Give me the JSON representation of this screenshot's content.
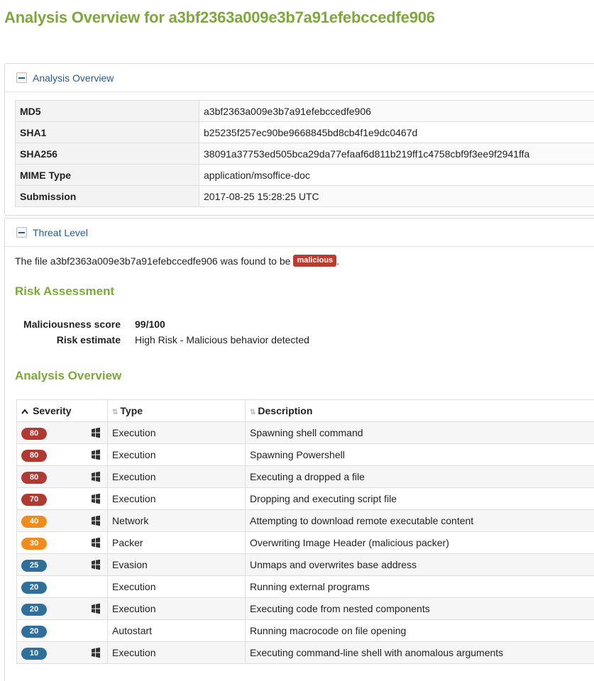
{
  "page_title": "Analysis Overview for a3bf2363a009e3b7a91efebccedfe906",
  "overview_panel": {
    "heading": "Analysis Overview",
    "rows": [
      {
        "key": "MD5",
        "value": "a3bf2363a009e3b7a91efebccedfe906"
      },
      {
        "key": "SHA1",
        "value": "b25235f257ec90be9668845bd8cb4f1e9dc0467d"
      },
      {
        "key": "SHA256",
        "value": "38091a37753ed505bca29da77efaaf6d811b219ff1c4758cbf9f3ee9f2941ffa"
      },
      {
        "key": "MIME Type",
        "value": "application/msoffice-doc"
      },
      {
        "key": "Submission",
        "value": "2017-08-25 15:28:25 UTC"
      }
    ]
  },
  "threat_panel": {
    "heading": "Threat Level",
    "verdict_prefix": "The file a3bf2363a009e3b7a91efebccedfe906 was found to be",
    "verdict_badge": "malicious",
    "verdict_suffix": ".",
    "risk_heading": "Risk Assessment",
    "risk": {
      "score_label": "Maliciousness score",
      "score_value": "99/100",
      "estimate_label": "Risk estimate",
      "estimate_value": "High Risk - Malicious behavior detected"
    },
    "analysis_heading": "Analysis Overview",
    "table": {
      "headers": {
        "severity": "Severity",
        "type": "Type",
        "description": "Description"
      },
      "rows": [
        {
          "score": "80",
          "level": "red",
          "windows_icon": true,
          "type": "Execution",
          "description": "Spawning shell command"
        },
        {
          "score": "80",
          "level": "red",
          "windows_icon": true,
          "type": "Execution",
          "description": "Spawning Powershell"
        },
        {
          "score": "80",
          "level": "red",
          "windows_icon": true,
          "type": "Execution",
          "description": "Executing a dropped a file"
        },
        {
          "score": "70",
          "level": "red",
          "windows_icon": true,
          "type": "Execution",
          "description": "Dropping and executing script file"
        },
        {
          "score": "40",
          "level": "orange",
          "windows_icon": true,
          "type": "Network",
          "description": "Attempting to download remote executable content"
        },
        {
          "score": "30",
          "level": "orange",
          "windows_icon": true,
          "type": "Packer",
          "description": "Overwriting Image Header (malicious packer)"
        },
        {
          "score": "25",
          "level": "blue",
          "windows_icon": true,
          "type": "Evasion",
          "description": "Unmaps and overwrites base address"
        },
        {
          "score": "20",
          "level": "blue",
          "windows_icon": false,
          "type": "Execution",
          "description": "Running external programs"
        },
        {
          "score": "20",
          "level": "blue",
          "windows_icon": true,
          "type": "Execution",
          "description": "Executing code from nested components"
        },
        {
          "score": "20",
          "level": "blue",
          "windows_icon": false,
          "type": "Autostart",
          "description": "Running macrocode on file opening"
        },
        {
          "score": "10",
          "level": "blue",
          "windows_icon": true,
          "type": "Execution",
          "description": "Executing command-line shell with anomalous arguments"
        }
      ]
    }
  },
  "colors": {
    "title_green": "#7da83a",
    "link_blue": "#2a5b88",
    "badge_red": "#b03a32",
    "badge_orange": "#ef8c1d",
    "badge_blue": "#2e6f9c"
  },
  "icons": {
    "collapse": "minus-icon",
    "platform": "windows-icon",
    "sort_active": "chevron-up-icon",
    "sort_inactive": "sort-icon"
  }
}
